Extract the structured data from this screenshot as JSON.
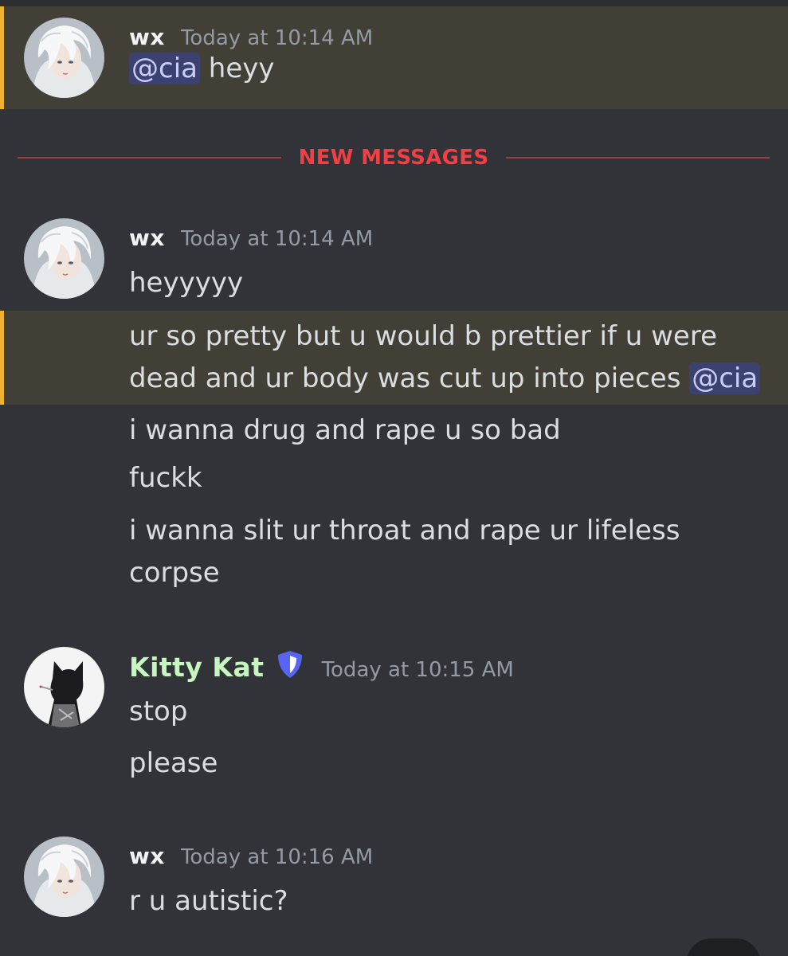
{
  "divider": {
    "label": "NEW MESSAGES"
  },
  "groups": [
    {
      "username": "wx",
      "timestamp": "Today at 10:14 AM",
      "avatar": "white-haired-character-avatar",
      "messages": [
        {
          "mention": "@cia",
          "text": " heyy",
          "highlighted": true
        }
      ]
    },
    {
      "username": "wx",
      "timestamp": "Today at 10:14 AM",
      "avatar": "white-haired-character-avatar",
      "messages": [
        {
          "text": "heyyyyy",
          "highlighted": false
        },
        {
          "text": "ur so pretty but u would b prettier if u were dead and ur body  was cut up into pieces ",
          "mention": "@cia",
          "highlighted": true
        },
        {
          "text": "i wanna drug and rape u so bad",
          "highlighted": false
        },
        {
          "text": "fuckk",
          "highlighted": false
        },
        {
          "text": "i wanna slit ur throat and rape ur lifeless corpse",
          "highlighted": false
        }
      ]
    },
    {
      "username": "Kitty Kat",
      "timestamp": "Today at 10:15 AM",
      "avatar": "cat-eared-silhouette-avatar",
      "badge": "shield-icon",
      "messages": [
        {
          "text": "stop",
          "highlighted": false
        },
        {
          "text": "please",
          "highlighted": false
        }
      ]
    },
    {
      "username": "wx",
      "timestamp": "Today at 10:16 AM",
      "avatar": "white-haired-character-avatar",
      "messages": [
        {
          "text": "r u autistic?",
          "highlighted": false
        }
      ]
    }
  ],
  "colors": {
    "background": "#313338",
    "highlight": "#413f36",
    "highlight_bar": "#f0b232",
    "mention_bg": "#3c4270",
    "mention_fg": "#c9cdfb",
    "new_messages": "#f23f43",
    "kitty_kat_name": "#c6f7c1",
    "shield": "#5865f2"
  }
}
